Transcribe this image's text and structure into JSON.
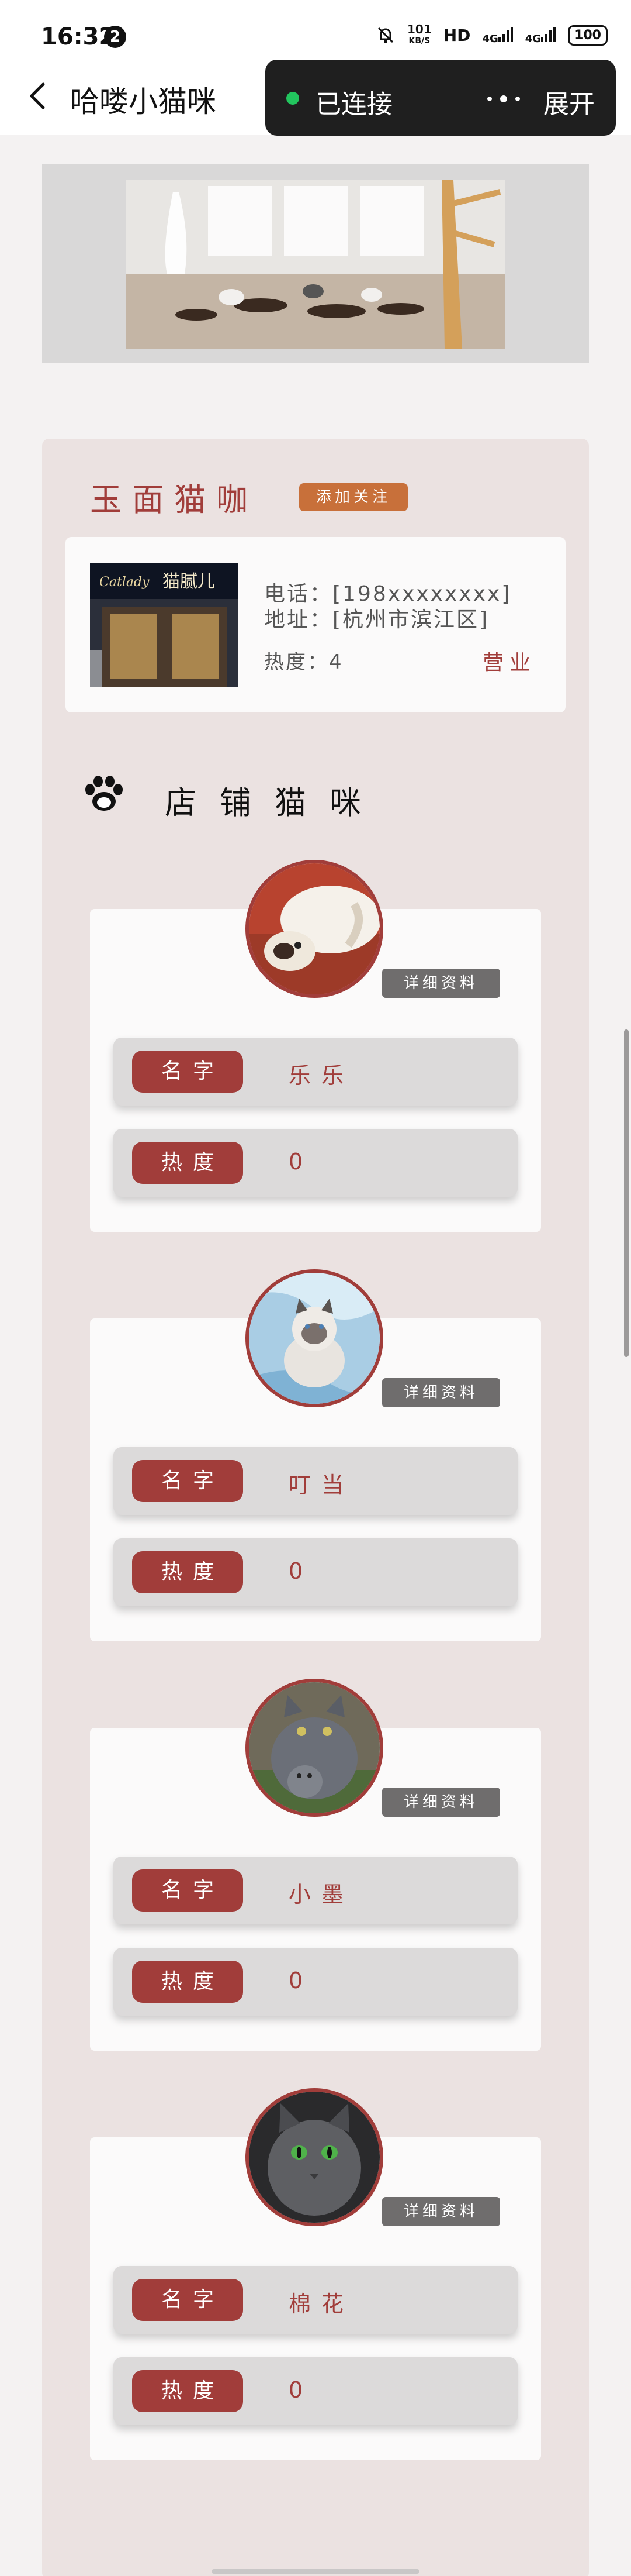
{
  "status_bar": {
    "time": "16:32",
    "notif_count": "2",
    "net_speed_top": "101",
    "net_speed_unit": "KB/S",
    "hd": "HD",
    "signal1": "4G",
    "signal2": "4G",
    "battery": "100"
  },
  "header": {
    "title": "哈喽小猫咪",
    "connection_status": "已连接",
    "expand_label": "展开"
  },
  "shop": {
    "name": "玉面猫咖",
    "follow_label": "添加关注",
    "phone": "电话：[198xxxxxxxx]",
    "address": "地址：[杭州市滨江区]",
    "heat": "热度：4",
    "status": "营业"
  },
  "section": {
    "title": "店铺猫咪"
  },
  "cats_labels": {
    "detail": "详细资料",
    "name": "名字",
    "heat": "热度"
  },
  "cats": [
    {
      "name": "乐乐",
      "heat": "0"
    },
    {
      "name": "叮当",
      "heat": "0"
    },
    {
      "name": "小墨",
      "heat": "0"
    },
    {
      "name": "棉花",
      "heat": "0"
    }
  ],
  "colors": {
    "accent": "#a13d3a",
    "follow": "#c8703a",
    "panel": "#ebe2e1",
    "connected_dot": "#22c55e"
  }
}
